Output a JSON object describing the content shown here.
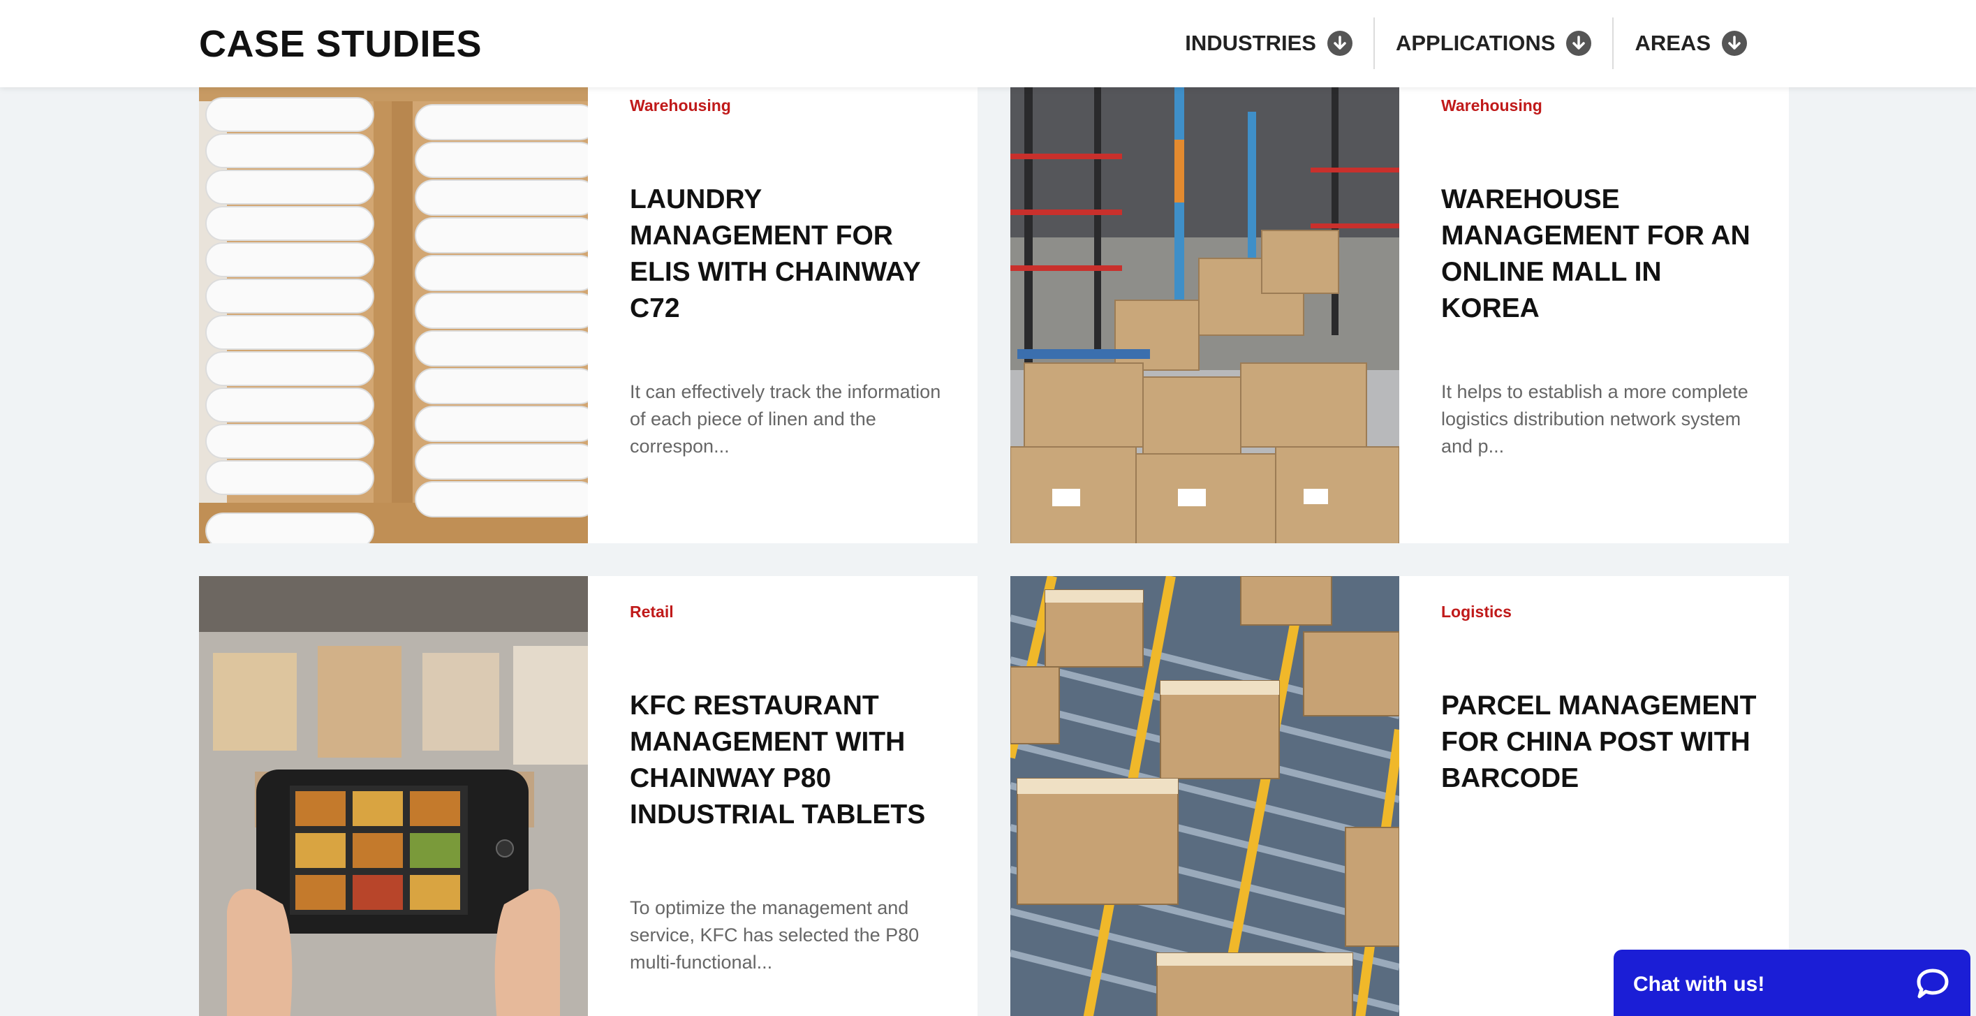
{
  "header": {
    "title": "CASE STUDIES",
    "nav": [
      {
        "label": "INDUSTRIES",
        "icon": "arrow-down-circle-icon"
      },
      {
        "label": "APPLICATIONS",
        "icon": "arrow-down-circle-icon"
      },
      {
        "label": "AREAS",
        "icon": "arrow-down-circle-icon"
      }
    ]
  },
  "cards": [
    {
      "category": "Warehousing",
      "title": "LAUNDRY MANAGEMENT FOR ELIS WITH CHAINWAY C72",
      "description": "It can effectively track the information of each piece of linen and the correspon...",
      "image": "stacked-towels-image"
    },
    {
      "category": "Warehousing",
      "title": "WAREHOUSE MANAGEMENT FOR AN ONLINE MALL IN KOREA",
      "description": "It helps to establish a more complete logistics distribution network system and p...",
      "image": "warehouse-boxes-image"
    },
    {
      "category": "Retail",
      "title": "KFC RESTAURANT MANAGEMENT WITH CHAINWAY P80 INDUSTRIAL TABLETS",
      "description": "To optimize the management and service, KFC has selected the P80 multi-functional...",
      "image": "tablet-in-hands-image"
    },
    {
      "category": "Logistics",
      "title": "PARCEL MANAGEMENT FOR CHINA POST WITH BARCODE",
      "description": "",
      "image": "parcels-on-conveyor-image"
    }
  ],
  "chat": {
    "label": "Chat with us!",
    "icon": "chat-bubble-icon",
    "color": "#1b1ed6"
  },
  "colors": {
    "accent": "#c01a1a",
    "background": "#f0f3f5"
  }
}
